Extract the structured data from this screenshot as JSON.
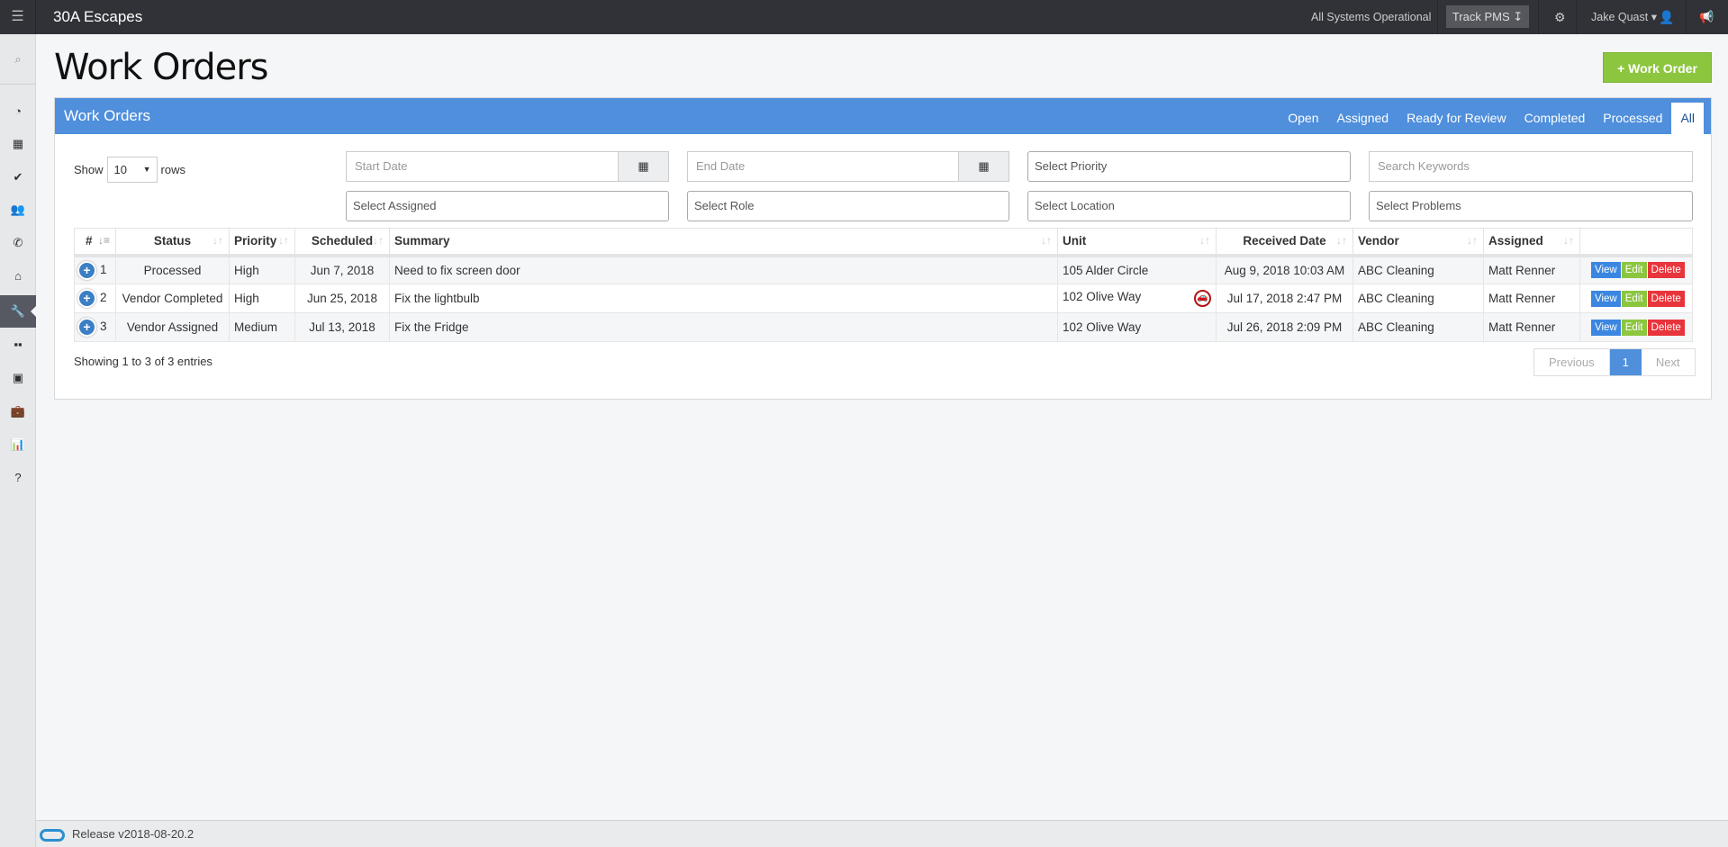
{
  "topbar": {
    "brand": "30A Escapes",
    "status": "All Systems Operational",
    "track_pms": "Track PMS ↧",
    "user": "Jake Quast ▾"
  },
  "page": {
    "title": "Work Orders",
    "add_button": "+ Work Order"
  },
  "panel": {
    "title": "Work Orders",
    "tabs": [
      "Open",
      "Assigned",
      "Ready for Review",
      "Completed",
      "Processed",
      "All"
    ],
    "active_tab": "All"
  },
  "filters": {
    "show_label": "Show",
    "rows_value": "10",
    "rows_label": "rows",
    "start_date": "Start Date",
    "end_date": "End Date",
    "priority": "Select Priority",
    "keywords": "Search Keywords",
    "assigned": "Select Assigned",
    "role": "Select Role",
    "location": "Select Location",
    "problems": "Select Problems"
  },
  "table": {
    "headers": [
      "#",
      "Status",
      "Priority",
      "Scheduled",
      "Summary",
      "Unit",
      "Received Date",
      "Vendor",
      "Assigned"
    ],
    "rows": [
      {
        "num": "1",
        "status": "Processed",
        "priority": "High",
        "scheduled": "Jun 7, 2018",
        "summary": "Need to fix screen door",
        "unit": "105 Alder Circle",
        "received": "Aug 9, 2018 10:03 AM",
        "vendor": "ABC Cleaning",
        "assigned": "Matt Renner"
      },
      {
        "num": "2",
        "status": "Vendor Completed",
        "priority": "High",
        "scheduled": "Jun 25, 2018",
        "summary": "Fix the lightbulb",
        "unit": "102 Olive Way",
        "received": "Jul 17, 2018 2:47 PM",
        "vendor": "ABC Cleaning",
        "assigned": "Matt Renner"
      },
      {
        "num": "3",
        "status": "Vendor Assigned",
        "priority": "Medium",
        "scheduled": "Jul 13, 2018",
        "summary": "Fix the Fridge",
        "unit": "102 Olive Way",
        "received": "Jul 26, 2018 2:09 PM",
        "vendor": "ABC Cleaning",
        "assigned": "Matt Renner"
      }
    ],
    "actions": {
      "view": "View",
      "edit": "Edit",
      "delete": "Delete"
    }
  },
  "info": "Showing 1 to 3 of 3 entries",
  "pagination": {
    "previous": "Previous",
    "page": "1",
    "next": "Next"
  },
  "footer": {
    "release": "Release v2018-08-20.2"
  },
  "colors": {
    "accent": "#4f8fdc",
    "add": "#8cc63f",
    "delete": "#e8343b",
    "topbar": "#313237"
  }
}
